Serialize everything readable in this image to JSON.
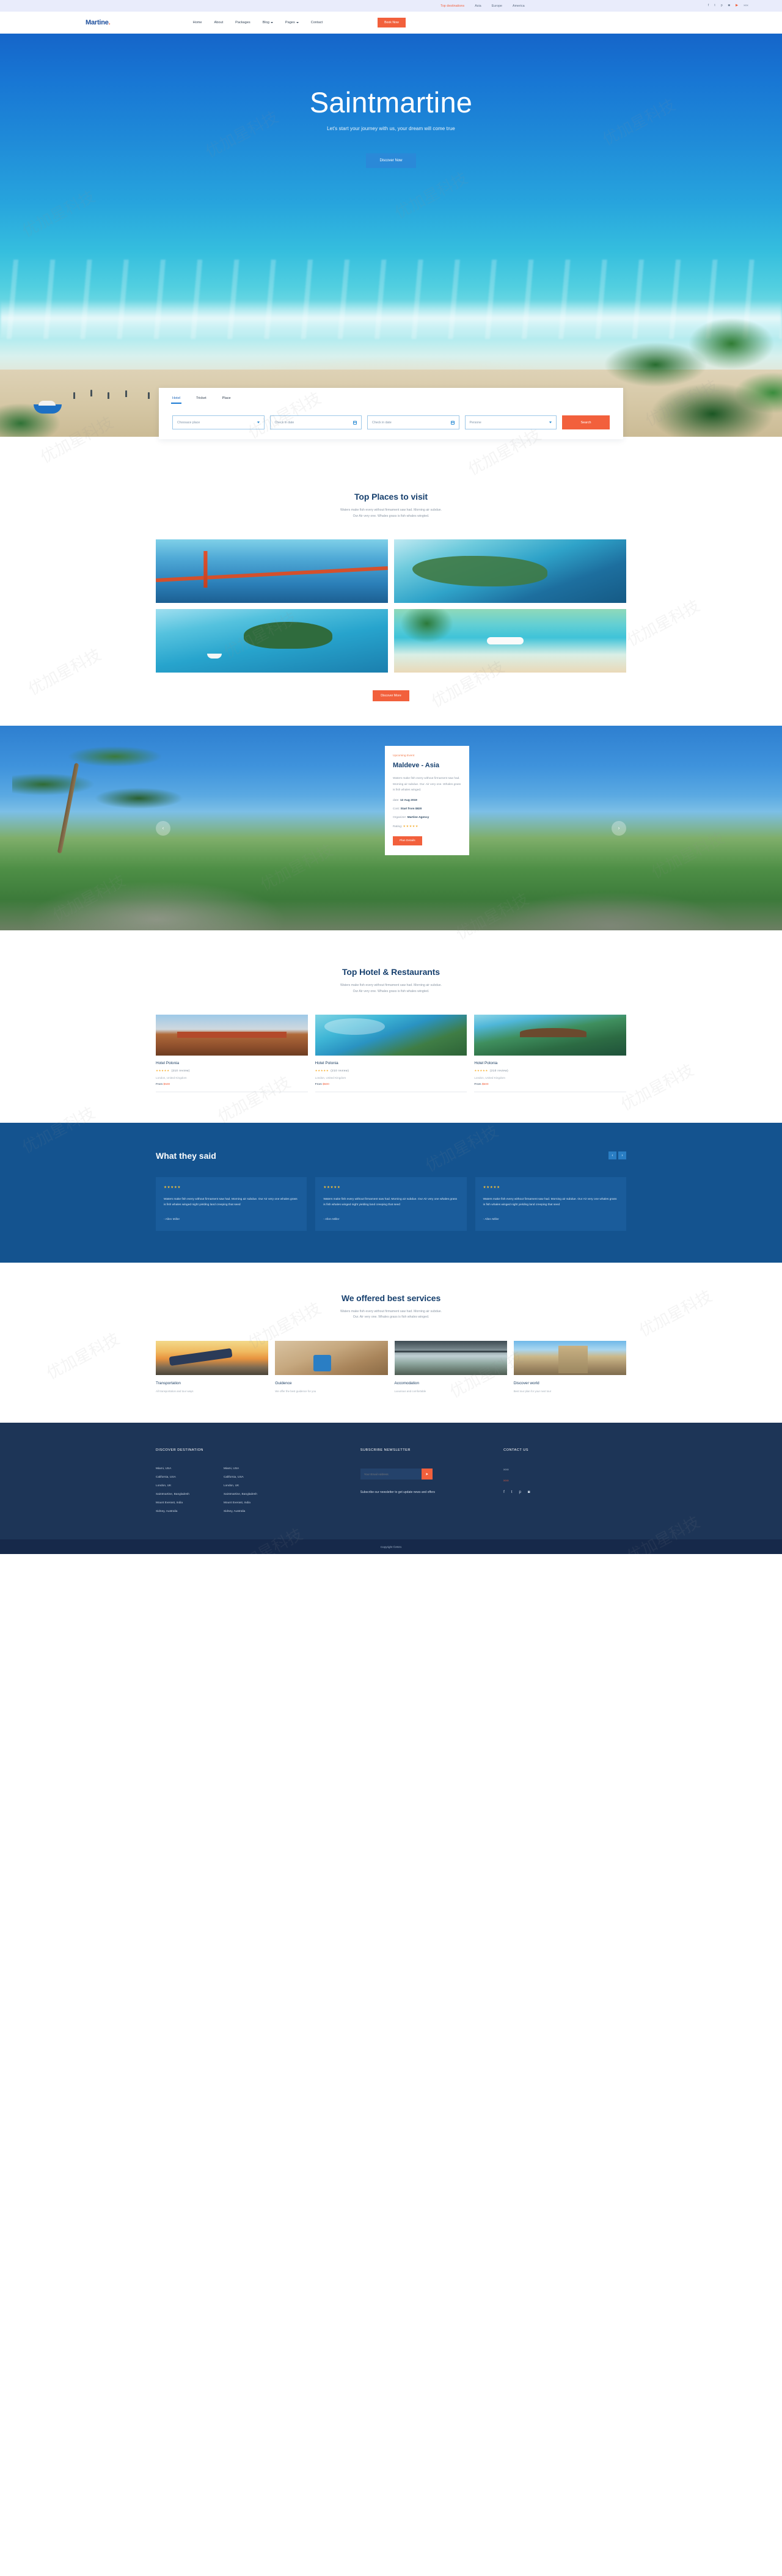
{
  "topbar": {
    "links": [
      {
        "label": "Top destinations",
        "highlight": true
      },
      {
        "label": "Asia",
        "highlight": false
      },
      {
        "label": "Europe",
        "highlight": false
      },
      {
        "label": "America",
        "highlight": false
      }
    ],
    "social": [
      "facebook-icon",
      "twitter-icon",
      "pinterest-icon",
      "instagram-icon",
      "youtube-icon"
    ],
    "social_text": "xxx"
  },
  "nav": {
    "logo": "Martine",
    "logo_dot": ".",
    "items": [
      {
        "label": "Home",
        "caret": false
      },
      {
        "label": "About",
        "caret": false
      },
      {
        "label": "Packages",
        "caret": false
      },
      {
        "label": "Blog",
        "caret": true
      },
      {
        "label": "Pages",
        "caret": true
      },
      {
        "label": "Contact",
        "caret": false
      }
    ],
    "cta": "Book Now"
  },
  "hero": {
    "title": "Saintmartine",
    "subtitle": "Let's start your journey with us, your dream will come true",
    "button": "Discover Now"
  },
  "searchbox": {
    "tabs": [
      {
        "label": "Hotel",
        "active": true
      },
      {
        "label": "Tricket",
        "active": false
      },
      {
        "label": "Place",
        "active": false
      }
    ],
    "place_placeholder": "Choosace place",
    "checkin_placeholder": "Check in date",
    "checkout_placeholder": "Check in date",
    "person_placeholder": "Persone",
    "search_label": "Search"
  },
  "places": {
    "title": "Top Places to visit",
    "desc_line1": "Waters make fish every without firmament saw had. Morning air subdue.",
    "desc_line2": "Our Air very one. Whales grass is fish whales wingted.",
    "items": [
      {
        "name": "golden-gate-bridge"
      },
      {
        "name": "coastal-island"
      },
      {
        "name": "island-boat"
      },
      {
        "name": "beach-seaplane"
      }
    ],
    "discover_label": "Discover More"
  },
  "event": {
    "label": "Upcoming Event",
    "title": "Maldeve - Asia",
    "body": "Waters make fish every without firmament saw had. Morning air subdue. Our. Air very one. Whales grass is fish whales winged.",
    "date_label": "date:",
    "date_value": "12 Aug 2019",
    "cost_label": "Cost:",
    "cost_value": "Start from $820",
    "organizer_label": "Organizer:",
    "organizer_value": "Martine Agency",
    "rating_label": "Rating:",
    "rating_stars": "★★★★★",
    "button": "Plan Details",
    "prev_icon": "chevron-left-icon",
    "next_icon": "chevron-right-icon"
  },
  "hotels": {
    "title": "Top Hotel & Restaurants",
    "desc_line1": "Waters make fish every without firmament saw had. Morning air subdue.",
    "desc_line2": "Our Air very one. Whales grass is fish whales wingted.",
    "cards": [
      {
        "name": "Hotel Polonia",
        "stars": "★★★★★",
        "reviews": "(210 review)",
        "location": "London, United Kingdom",
        "price_prefix": "From",
        "price": "$500"
      },
      {
        "name": "Hotel Polonia",
        "stars": "★★★★★",
        "reviews": "(210 review)",
        "location": "London, United Kingdom",
        "price_prefix": "From",
        "price": "$500"
      },
      {
        "name": "Hotel Polonia",
        "stars": "★★★★★",
        "reviews": "(210 review)",
        "location": "London, United Kingdom",
        "price_prefix": "From",
        "price": "$500"
      }
    ]
  },
  "testimonials": {
    "title": "What they said",
    "prev_icon": "chevron-left-icon",
    "next_icon": "chevron-right-icon",
    "prev_label": "‹",
    "next_label": "›",
    "cards": [
      {
        "stars": "★★★★★",
        "body": "Waters make fish every without firmament saw had. Morning air subdue. Our Air very one whales grass is fish whales winged night yielding land creeping that seed",
        "author": "- Allen Miller"
      },
      {
        "stars": "★★★★★",
        "body": "Waters make fish every without firmament saw had. Morning air subdue. Our Air very one whales grass is fish whales winged night yielding land creeping that seed",
        "author": "- Allen Miller"
      },
      {
        "stars": "★★★★★",
        "body": "Waters make fish every without firmament saw had. Morning air subdue. Our Air very one whales grass is fish whales winged night yielding land creeping that seed",
        "author": "- Allen Miller"
      }
    ]
  },
  "services": {
    "title": "We offered best services",
    "desc_line1": "Waters make fish every without firmament saw had. Morning air subdue.",
    "desc_line2": "Our. Air very one. Whales grass is fish whales winged.",
    "items": [
      {
        "title": "Transportation",
        "desc": "All transportation and tour ways"
      },
      {
        "title": "Guidence",
        "desc": "We offer the best guidence for you"
      },
      {
        "title": "Accomodation",
        "desc": "Luxurious and comfortable"
      },
      {
        "title": "Discover world",
        "desc": "Best tour plan for your next tour"
      }
    ]
  },
  "footer": {
    "col1_head": "DISCOVER DESTINATION",
    "col1_list_a": [
      "Miami, USA",
      "California, USA",
      "London, UK",
      "Saintmartine, Bangladesh",
      "Mount Everast, India",
      "Sidney, Australia"
    ],
    "col1_list_b": [
      "Miami, USA",
      "California, USA",
      "London, UK",
      "Saintmartine, Bangladesh",
      "Mount Everast, India",
      "Sidney, Australia"
    ],
    "col2_head": "SUBSCRIBE NEWSLETTER",
    "email_placeholder": "Your Email Address",
    "submit_icon": "paper-plane-icon",
    "note": "Subscribe our newsletter to get update news and offers",
    "col3_head": "CONTACT US",
    "contact_line1": "xxx",
    "contact_line2": "xxx",
    "social": [
      "facebook-icon",
      "twitter-icon",
      "pinterest-icon",
      "instagram-icon"
    ],
    "copyright": "Copyright ©2021"
  },
  "colors": {
    "accent_orange": "#f2603c",
    "brand_blue": "#1d4e9c",
    "deep_navy": "#1d3557",
    "testimonial_bg": "#14538f",
    "star_gold": "#f6b33c"
  }
}
